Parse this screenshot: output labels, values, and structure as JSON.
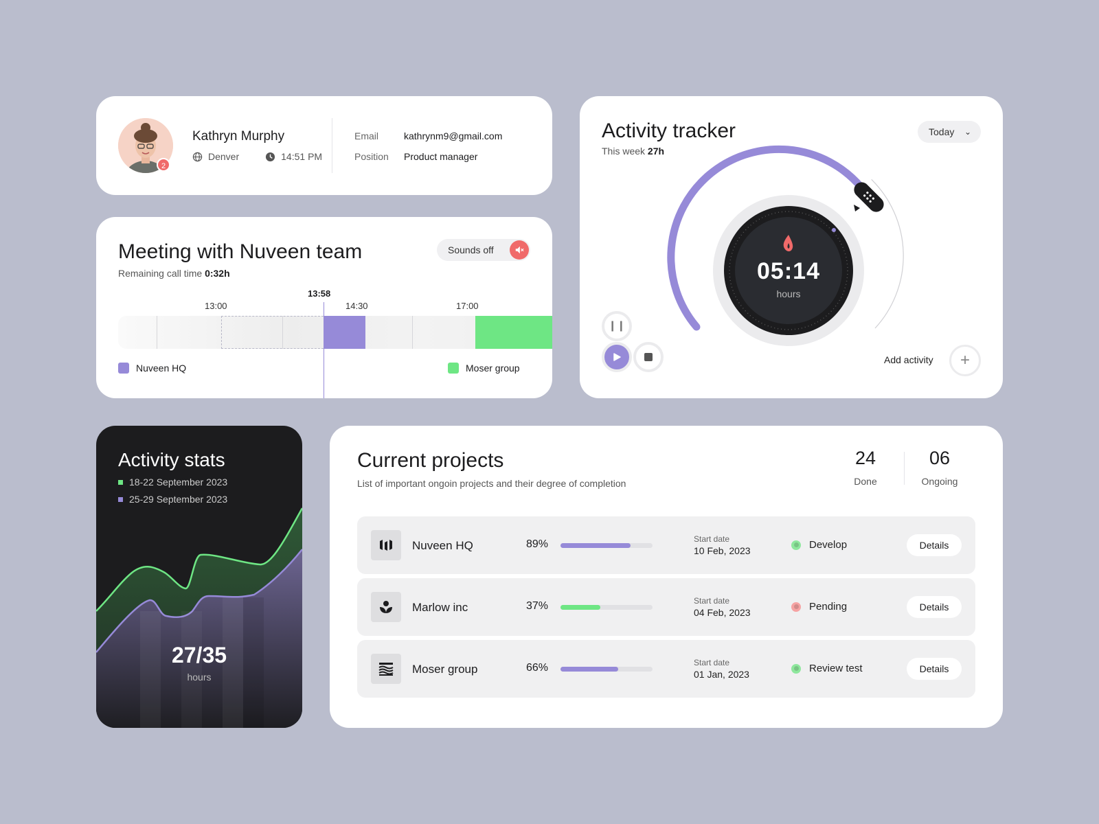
{
  "profile": {
    "name": "Kathryn Murphy",
    "location": "Denver",
    "time": "14:51 PM",
    "notification_count": "2",
    "email_label": "Email",
    "email": "kathrynm9@gmail.com",
    "position_label": "Position",
    "position": "Product manager"
  },
  "meeting": {
    "title": "Meeting with Nuveen team",
    "remaining_label": "Remaining call time",
    "remaining_value": "0:32h",
    "sounds_label": "Sounds off",
    "timeline": {
      "ticks": [
        "13:00",
        "14:30",
        "17:00"
      ],
      "current": "13:58"
    },
    "legend": [
      {
        "label": "Nuveen HQ",
        "color": "#968ad8"
      },
      {
        "label": "Moser group",
        "color": "#6ee684"
      }
    ]
  },
  "tracker": {
    "title": "Activity tracker",
    "week_label": "This week",
    "week_value": "27h",
    "range_select": "Today",
    "timer": "05:14",
    "timer_unit": "hours",
    "add_label": "Add activity",
    "accent": "#968ad8"
  },
  "stats": {
    "title": "Activity stats",
    "legend": [
      {
        "label": "18-22 September 2023",
        "color": "#6ee684"
      },
      {
        "label": "25-29 September 2023",
        "color": "#968ad8"
      }
    ],
    "value": "27/35",
    "unit": "hours"
  },
  "projects": {
    "title": "Current projects",
    "subtitle": "List of important ongoin projects and their degree of completion",
    "done_count": "24",
    "done_label": "Done",
    "ongoing_count": "06",
    "ongoing_label": "Ongoing",
    "start_date_label": "Start date",
    "details_label": "Details",
    "rows": [
      {
        "name": "Nuveen HQ",
        "percent": "89%",
        "progress": 0.76,
        "bar_color": "#968ad8",
        "start_date": "10 Feb, 2023",
        "status": "Develop",
        "status_color": "#8ee79d",
        "logo": "nuveen-logo-icon"
      },
      {
        "name": "Marlow inc",
        "percent": "37%",
        "progress": 0.43,
        "bar_color": "#6ee684",
        "start_date": "04 Feb, 2023",
        "status": "Pending",
        "status_color": "#f6a3a3",
        "logo": "marlow-logo-icon"
      },
      {
        "name": "Moser group",
        "percent": "66%",
        "progress": 0.63,
        "bar_color": "#968ad8",
        "start_date": "01 Jan, 2023",
        "status": "Review test",
        "status_color": "#8ee79d",
        "logo": "moser-logo-icon"
      }
    ]
  }
}
